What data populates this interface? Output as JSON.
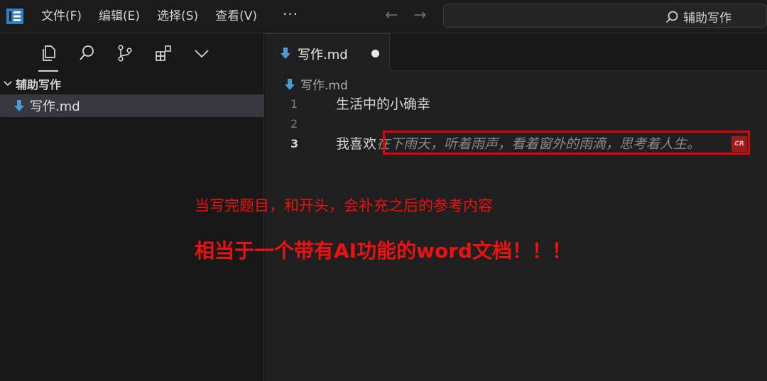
{
  "menu": {
    "items": [
      "文件(F)",
      "编辑(E)",
      "选择(S)",
      "查看(V)"
    ],
    "more": "···"
  },
  "nav": {
    "back": "←",
    "forward": "→"
  },
  "search": {
    "text": "辅助写作"
  },
  "explorer": {
    "root_label": "辅助写作",
    "files": [
      {
        "label": "写作.md",
        "selected": true
      }
    ]
  },
  "tabs": [
    {
      "label": "写作.md",
      "dirty": true
    }
  ],
  "breadcrumb": {
    "file": "写作.md"
  },
  "editor": {
    "lines": [
      {
        "num": "1",
        "text": "生活中的小确幸"
      },
      {
        "num": "2",
        "text": ""
      },
      {
        "num": "3",
        "text": "我喜欢",
        "ghost": "在下雨天，听着雨声，看着窗外的雨滴，思考着人生。",
        "badge": "CR"
      }
    ]
  },
  "annotations": {
    "line1": "当写完题目，和开头，会补充之后的参考内容",
    "line2": "相当于一个带有AI功能的word文档！！！"
  },
  "colors": {
    "background": "#1b1b1b",
    "annotation": "#ee1111",
    "markdown_icon": "#4a9ad4",
    "logo": "#2f80c7"
  }
}
